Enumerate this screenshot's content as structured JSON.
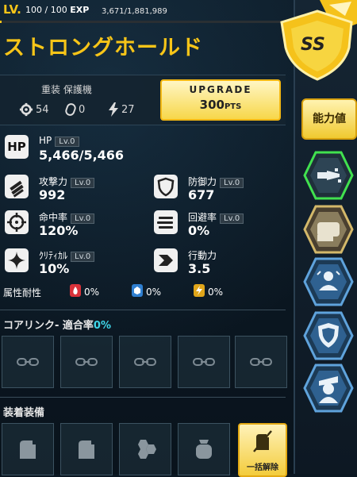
{
  "header": {
    "lv_label": "LV.",
    "level": "100 / 100",
    "exp_label": "EXP",
    "exp_value": "3,671/1,881,989",
    "exp_progress": 0.002
  },
  "unit": {
    "name": "ストロングホールド",
    "category": "重装 保護機",
    "stat_a": "54",
    "stat_b": "0",
    "stat_c": "27"
  },
  "upgrade": {
    "label": "UPGRADE",
    "points": "300",
    "unit": "PTS"
  },
  "stats": {
    "hp": {
      "name": "HP",
      "lv": "Lv.0",
      "value": "5,466/5,466"
    },
    "atk": {
      "name": "攻撃力",
      "lv": "Lv.0",
      "value": "992"
    },
    "def": {
      "name": "防御力",
      "lv": "Lv.0",
      "value": "677"
    },
    "acc": {
      "name": "命中率",
      "lv": "Lv.0",
      "value": "120%"
    },
    "eva": {
      "name": "回避率",
      "lv": "Lv.0",
      "value": "0%"
    },
    "crit": {
      "name": "ｸﾘﾃｨｶﾙ",
      "lv": "Lv.0",
      "value": "10%"
    },
    "spd": {
      "name": "行動力",
      "value": "3.5"
    }
  },
  "resist": {
    "label": "属性耐性",
    "fire": "0%",
    "ice": "0%",
    "electric": "0%",
    "colors": {
      "fire": "#d9323a",
      "ice": "#2f7fd0",
      "electric": "#e0a61a"
    }
  },
  "core_link": {
    "label": "コアリンク- 適合率",
    "rate": "0%"
  },
  "equipment": {
    "label": "装着装備",
    "bulk_remove": "一括解除"
  },
  "sidebar": {
    "ability_label": "能力値",
    "rank_label": "SS"
  },
  "colors": {
    "accent": "#f7c518",
    "cyan": "#3fd6e9"
  }
}
